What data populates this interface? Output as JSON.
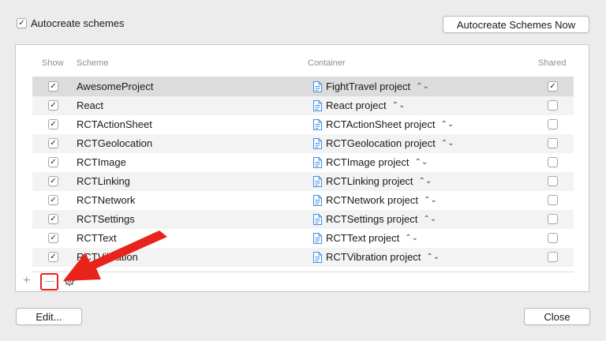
{
  "top": {
    "autocreate_checked": true,
    "autocreate_label": "Autocreate schemes",
    "autocreate_now_button": "Autocreate Schemes Now"
  },
  "headers": {
    "show": "Show",
    "scheme": "Scheme",
    "container": "Container",
    "shared": "Shared"
  },
  "rows": [
    {
      "show": true,
      "scheme": "AwesomeProject",
      "container": "FightTravel project",
      "shared": true,
      "selected": true
    },
    {
      "show": true,
      "scheme": "React",
      "container": "React project",
      "shared": false
    },
    {
      "show": true,
      "scheme": "RCTActionSheet",
      "container": "RCTActionSheet project",
      "shared": false
    },
    {
      "show": true,
      "scheme": "RCTGeolocation",
      "container": "RCTGeolocation project",
      "shared": false
    },
    {
      "show": true,
      "scheme": "RCTImage",
      "container": "RCTImage project",
      "shared": false
    },
    {
      "show": true,
      "scheme": "RCTLinking",
      "container": "RCTLinking project",
      "shared": false
    },
    {
      "show": true,
      "scheme": "RCTNetwork",
      "container": "RCTNetwork project",
      "shared": false
    },
    {
      "show": true,
      "scheme": "RCTSettings",
      "container": "RCTSettings project",
      "shared": false
    },
    {
      "show": true,
      "scheme": "RCTText",
      "container": "RCTText project",
      "shared": false
    },
    {
      "show": true,
      "scheme": "RCTVibration",
      "container": "RCTVibration project",
      "shared": false
    }
  ],
  "toolbar": {
    "add_icon": "plus-icon",
    "remove_icon": "minus-icon",
    "gear_icon": "gear-icon"
  },
  "footer": {
    "edit_button": "Edit...",
    "close_button": "Close"
  },
  "colors": {
    "annotation_red": "#e8231b",
    "file_icon_blue": "#3d8ee6",
    "selected_row": "#dcdcdc"
  }
}
